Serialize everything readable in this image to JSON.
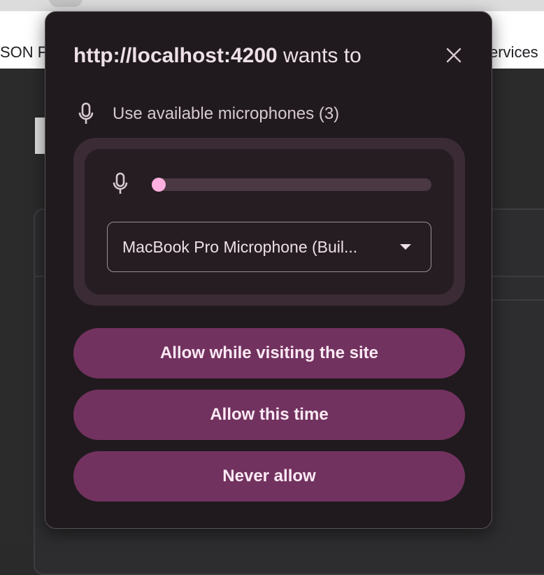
{
  "background": {
    "bookmark_left": "SON F",
    "bookmark_right": "ervices"
  },
  "dialog": {
    "origin": "http://localhost:4200",
    "title_suffix": " wants to",
    "permission": {
      "icon": "microphone-icon",
      "label": "Use available microphones (3)"
    },
    "mic_level": {
      "icon": "microphone-icon",
      "level": 0
    },
    "device_select": {
      "value": "MacBook Pro Microphone (Buil..."
    },
    "buttons": {
      "allow_visiting": "Allow while visiting the site",
      "allow_once": "Allow this time",
      "never": "Never allow"
    }
  },
  "colors": {
    "dialog_bg": "#201a1e",
    "button_bg": "#72325f",
    "accent": "#ffb0e0"
  }
}
